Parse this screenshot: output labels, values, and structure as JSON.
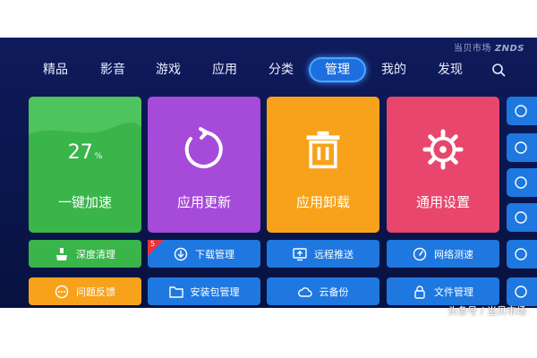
{
  "brand": {
    "name": "当贝市场",
    "logo": "ZNDS"
  },
  "nav": {
    "tabs": [
      {
        "label": "精品",
        "active": false
      },
      {
        "label": "影音",
        "active": false
      },
      {
        "label": "游戏",
        "active": false
      },
      {
        "label": "应用",
        "active": false
      },
      {
        "label": "分类",
        "active": false
      },
      {
        "label": "管理",
        "active": true
      },
      {
        "label": "我的",
        "active": false
      },
      {
        "label": "发现",
        "active": false
      }
    ],
    "search_icon": "search-icon"
  },
  "tiles": {
    "speedup": {
      "percent": "27",
      "percent_unit": "%",
      "label": "一键加速",
      "color": "#39b54a"
    },
    "update": {
      "label": "应用更新",
      "icon": "refresh-icon",
      "color": "#a64ad9"
    },
    "uninstall": {
      "label": "应用卸载",
      "icon": "trash-icon",
      "color": "#f7a21a"
    },
    "settings": {
      "label": "通用设置",
      "icon": "gear-icon",
      "color": "#e8466c"
    }
  },
  "buttons": {
    "deep_clean": {
      "label": "深度清理",
      "icon": "broom-icon"
    },
    "download_mgmt": {
      "label": "下载管理",
      "icon": "download-icon",
      "badge": "5"
    },
    "remote_push": {
      "label": "远程推送",
      "icon": "monitor-upload-icon"
    },
    "net_speed": {
      "label": "网络测速",
      "icon": "speedometer-icon"
    },
    "feedback": {
      "label": "问题反馈",
      "icon": "chat-icon"
    },
    "apk_mgmt": {
      "label": "安装包管理",
      "icon": "folder-icon"
    },
    "cloud_backup": {
      "label": "云备份",
      "icon": "cloud-icon"
    },
    "file_mgmt": {
      "label": "文件管理",
      "icon": "lock-file-icon"
    }
  },
  "watermark": "头条号 / 当贝市场"
}
